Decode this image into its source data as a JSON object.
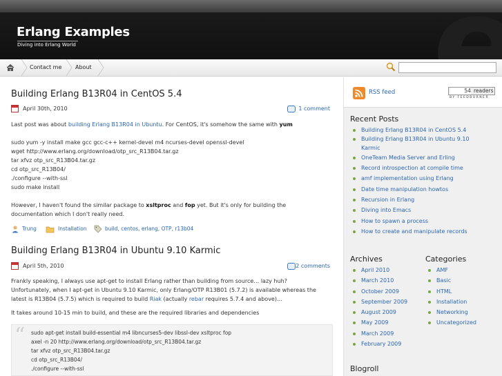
{
  "site": {
    "title": "Erlang Examples",
    "description": "Diving into Erlang World"
  },
  "nav": {
    "items": [
      "Contact me",
      "About"
    ]
  },
  "search": {
    "placeholder": ""
  },
  "posts": [
    {
      "title": "Building Erlang B13R04 in CentOS 5.4",
      "date": "April 30th, 2010",
      "comments": "1 comment",
      "lines": [
        {
          "pre": "Last post was about ",
          "link": "building Erlang B13R04 in Ubuntu",
          "mid": ". For CentOS, it's somehow the same with ",
          "bold": "yum"
        },
        {
          "text": "sudo yum -y install make gcc gcc-c++ kernel-devel m4 ncurses-devel openssl-devel"
        },
        {
          "text": "wget http://www.erlang.org/download/otp_src_R13B04.tar.gz"
        },
        {
          "text": "tar xfvz otp_src_R13B04.tar.gz"
        },
        {
          "text": "cd otp_src_R13B04/"
        },
        {
          "text": "./configure --with-ssl"
        },
        {
          "text": "sudo make install"
        },
        {
          "p1": "However, I haven't found the similar package to ",
          "b1": "xsltproc",
          "p2": " and ",
          "b2": "fop",
          "p3": " yet. But it's only for building the"
        },
        {
          "text": "documentation which I don't really need."
        }
      ],
      "author": "Trung",
      "category": "Installation",
      "tags": "build, centos, erlang, OTP, r13b04"
    },
    {
      "title": "Building Erlang B13R04 in Ubuntu 9.10 Karmic",
      "date": "April 5th, 2010",
      "comments": "2 comments",
      "line1": "Frankly speaking, I always use apt-get to install Erlang rather than building from source… lazy huh?",
      "line2": "Unfortunately, when I apt-get in Ubuntu 9.10 Karmic, only Erlang/OTP R13B01 (5.7.2) is available whereas the",
      "line3_pre": "latest is R13B04 (5.7.5) which is required to build ",
      "line3_link1": "Riak",
      "line3_mid": " (actually ",
      "line3_link2": "rebar",
      "line3_post": " requires 5.7.4 and above)…",
      "line4": "It takes around 10-15 min to build, and these are the required libraries and dependencies",
      "quote": "sudo apt-get install build-essential m4 libncurses5-dev libssl-dev xsltproc fop\naxel -n 20 http://www.erlang.org/download/otp_src_R13B04.tar.gz\ntar xfvz otp_src_R13B04.tar.gz\ncd otp_src_R13B04/\n./configure --with-ssl"
    }
  ],
  "sidebar": {
    "rss_label": "RSS feed",
    "feedburner": {
      "count": "54",
      "readers": "readers",
      "by": "BY FEEDBURNER"
    },
    "recent_posts_title": "Recent Posts",
    "recent_posts": [
      "Building Erlang B13R04 in CentOS 5.4",
      "Building Erlang B13R04 in Ubuntu 9.10",
      "Karmic",
      "OneTeam Media Server and Erling",
      "Record introspection at compile time",
      "amf implementation using Erlang",
      "Date time manipulation howtos",
      "Recursion in Erlang",
      "Diving into Emacs",
      "How to spawn a process",
      "How to create and manipulate records"
    ],
    "archives_title": "Archives",
    "archives": [
      "April 2010",
      "March 2010",
      "October 2009",
      "September 2009",
      "August 2009",
      "May 2009",
      "March 2009",
      "February 2009"
    ],
    "categories_title": "Categories",
    "categories": [
      "AMF",
      "Basic",
      "HTML",
      "Installation",
      "Networking",
      "Uncategorized"
    ],
    "blogroll_title": "Blogroll"
  }
}
